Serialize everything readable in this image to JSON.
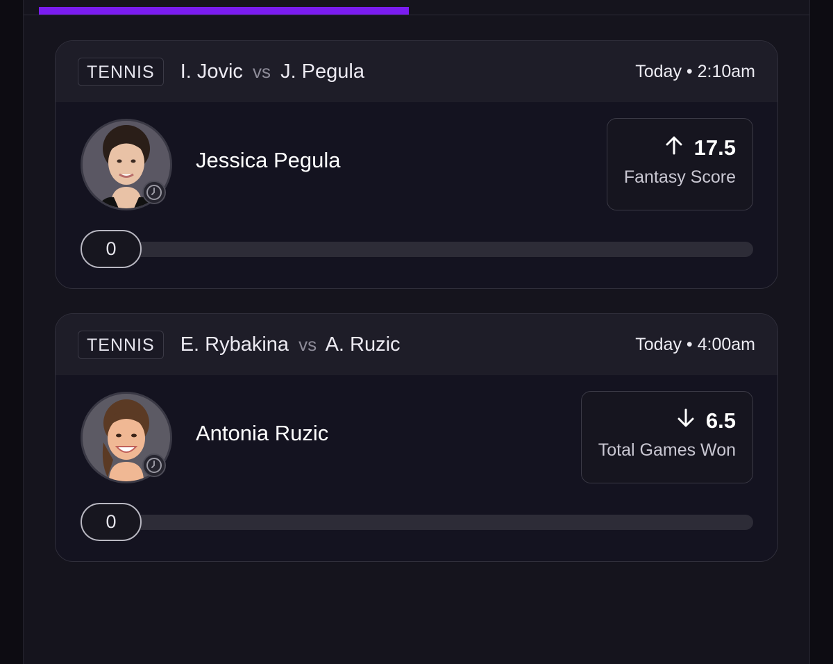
{
  "progress": {
    "fraction": 0.48,
    "color": "#7a1cf0"
  },
  "picks": [
    {
      "sport": "TENNIS",
      "player_a": "I. Jovic",
      "vs": "vs",
      "player_b": "J. Pegula",
      "time": "Today • 2:10am",
      "player_name": "Jessica Pegula",
      "direction": "up",
      "line": "17.5",
      "stat": "Fantasy Score",
      "current_value": "0"
    },
    {
      "sport": "TENNIS",
      "player_a": "E. Rybakina",
      "vs": "vs",
      "player_b": "A. Ruzic",
      "time": "Today • 4:00am",
      "player_name": "Antonia Ruzic",
      "direction": "down",
      "line": "6.5",
      "stat": "Total Games Won",
      "current_value": "0"
    }
  ]
}
